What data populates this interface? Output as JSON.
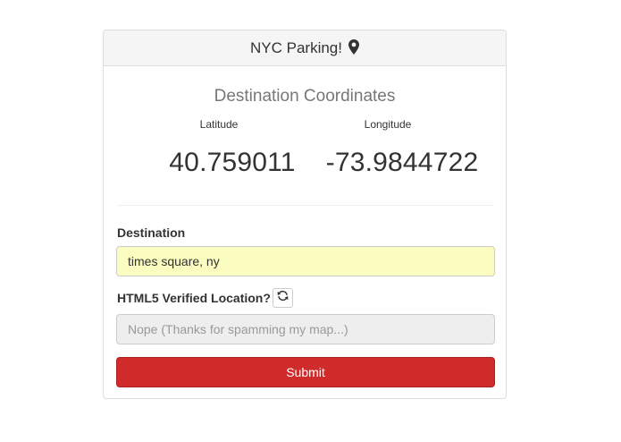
{
  "header": {
    "title": "NYC Parking!",
    "icon": "map-marker-icon"
  },
  "coordinates": {
    "title": "Destination Coordinates",
    "latitude_label": "Latitude",
    "longitude_label": "Longitude",
    "latitude_value": "40.759011",
    "longitude_value": "-73.9844722"
  },
  "form": {
    "destination_label": "Destination",
    "destination_value": "times square, ny",
    "verified_label": "HTML5 Verified Location?",
    "verified_placeholder": "Nope (Thanks for spamming my map...)",
    "refresh_icon": "refresh-icon",
    "submit_label": "Submit"
  },
  "colors": {
    "destination_bg": "#fafdbf",
    "submit_bg": "#d02b2b",
    "header_bg": "#f5f5f5"
  }
}
